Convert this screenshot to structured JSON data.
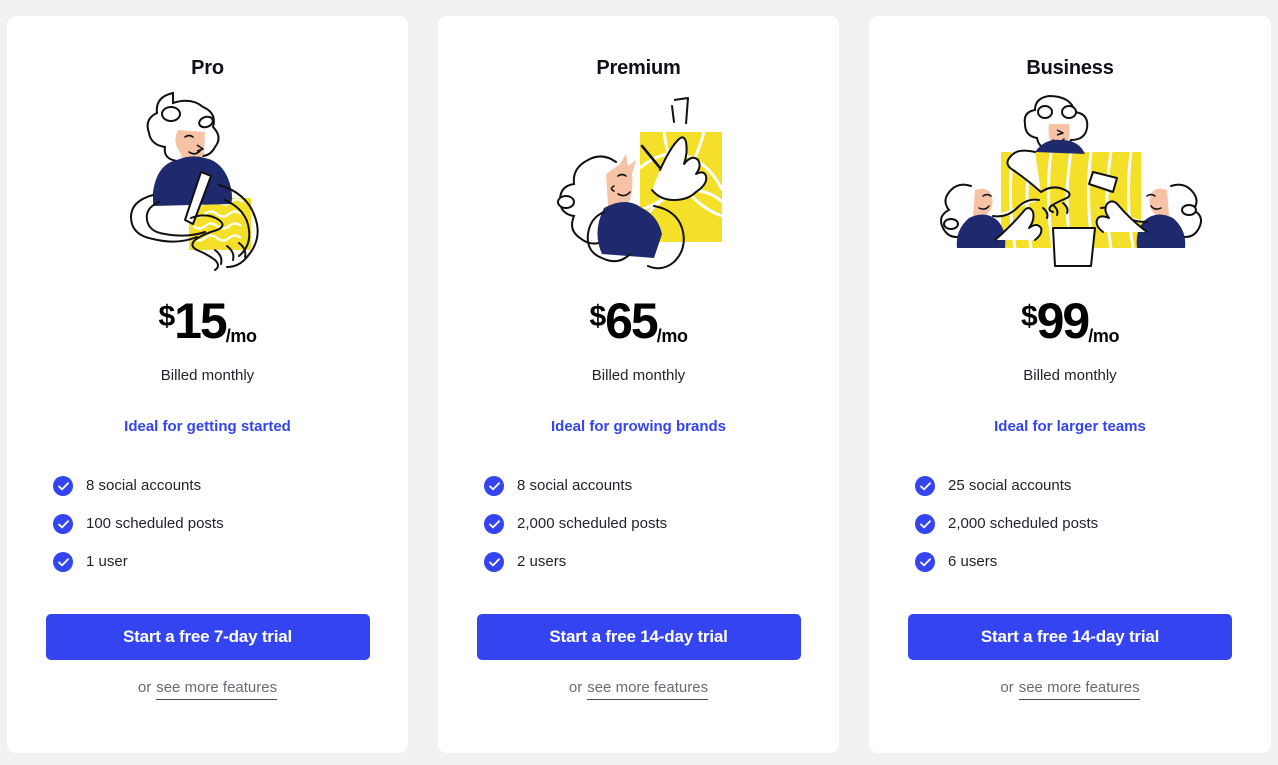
{
  "theme": {
    "page_background": "#f1f1f2",
    "card_background": "#ffffff",
    "accent_blue": "#3344f0",
    "navy": "#1f2a6e",
    "yellow": "#f5e029",
    "skin": "#f7c3a6",
    "text_dark": "#23232d",
    "text_muted": "#6a6a75"
  },
  "plans": [
    {
      "id": "pro",
      "title": "Pro",
      "illustration_name": "person-drawing-illustration",
      "currency": "$",
      "amount": "15",
      "period": "/mo",
      "billing": "Billed monthly",
      "tagline": "Ideal for getting started",
      "features": [
        "8 social accounts",
        "100 scheduled posts",
        "1 user"
      ],
      "cta": "Start a free 7-day trial",
      "more_prefix": "or",
      "more_link": "see more features"
    },
    {
      "id": "premium",
      "title": "Premium",
      "illustration_name": "person-presenting-board-illustration",
      "currency": "$",
      "amount": "65",
      "period": "/mo",
      "billing": "Billed monthly",
      "tagline": "Ideal for growing brands",
      "features": [
        "8 social accounts",
        "2,000 scheduled posts",
        "2 users"
      ],
      "cta": "Start a free 14-day trial",
      "more_prefix": "or",
      "more_link": "see more features"
    },
    {
      "id": "business",
      "title": "Business",
      "illustration_name": "team-collaborating-illustration",
      "currency": "$",
      "amount": "99",
      "period": "/mo",
      "billing": "Billed monthly",
      "tagline": "Ideal for larger teams",
      "features": [
        "25 social accounts",
        "2,000 scheduled posts",
        "6 users"
      ],
      "cta": "Start a free 14-day trial",
      "more_prefix": "or",
      "more_link": "see more features"
    }
  ]
}
